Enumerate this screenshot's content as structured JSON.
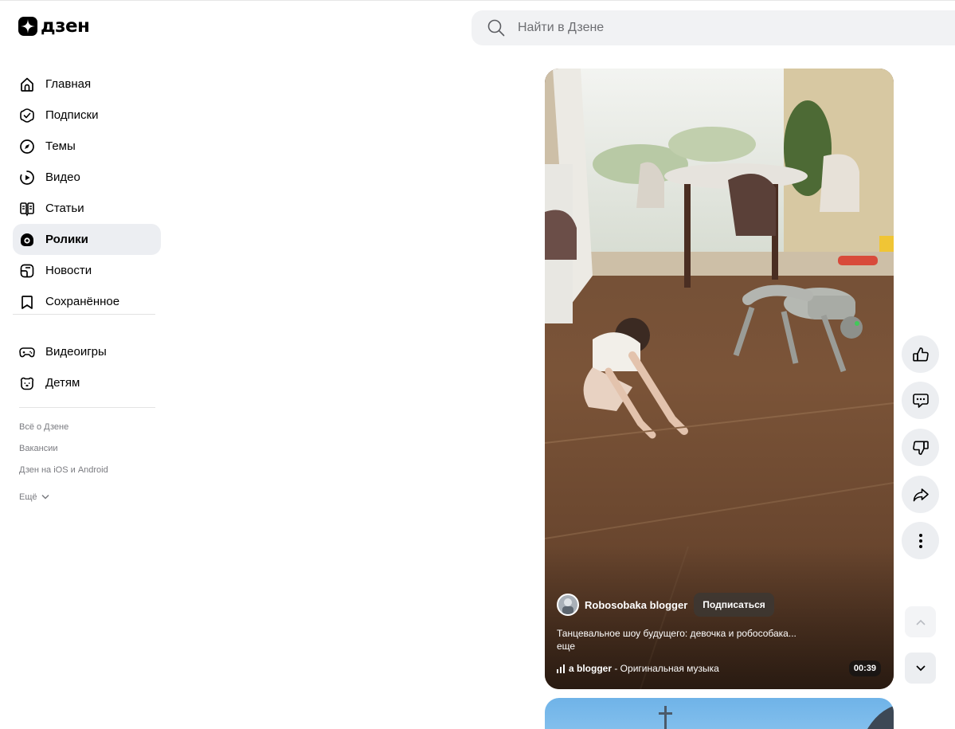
{
  "header": {
    "logo_text": "дзен",
    "search_placeholder": "Найти в Дзене"
  },
  "sidebar": {
    "items": [
      {
        "label": "Главная",
        "icon": "home-icon"
      },
      {
        "label": "Подписки",
        "icon": "subscriptions-icon"
      },
      {
        "label": "Темы",
        "icon": "compass-icon"
      },
      {
        "label": "Видео",
        "icon": "video-play-icon"
      },
      {
        "label": "Статьи",
        "icon": "book-icon"
      },
      {
        "label": "Ролики",
        "icon": "shorts-icon",
        "active": true
      },
      {
        "label": "Новости",
        "icon": "news-icon"
      },
      {
        "label": "Сохранённое",
        "icon": "bookmark-icon"
      }
    ],
    "secondary_items": [
      {
        "label": "Видеоигры",
        "icon": "gamepad-icon"
      },
      {
        "label": "Детям",
        "icon": "kids-bear-icon"
      }
    ],
    "footer_links": [
      "Всё о Дзене",
      "Вакансии",
      "Дзен на iOS и Android"
    ],
    "more_label": "Ещё"
  },
  "video": {
    "channel_name": "Robosobaka blogger",
    "subscribe_label": "Подписаться",
    "description": "Танцевальное шоу будущего: девочка и робособака...",
    "more_label": "еще",
    "music_author": "a blogger",
    "music_title": " - Оригинальная музыка",
    "duration": "00:39"
  },
  "actions": [
    "like-icon",
    "comments-icon",
    "dislike-icon",
    "share-icon",
    "more-vertical-icon"
  ],
  "colors": {
    "active_nav_bg": "#eceef2",
    "action_bg": "#eceef1",
    "search_bg": "#f1f2f4"
  }
}
